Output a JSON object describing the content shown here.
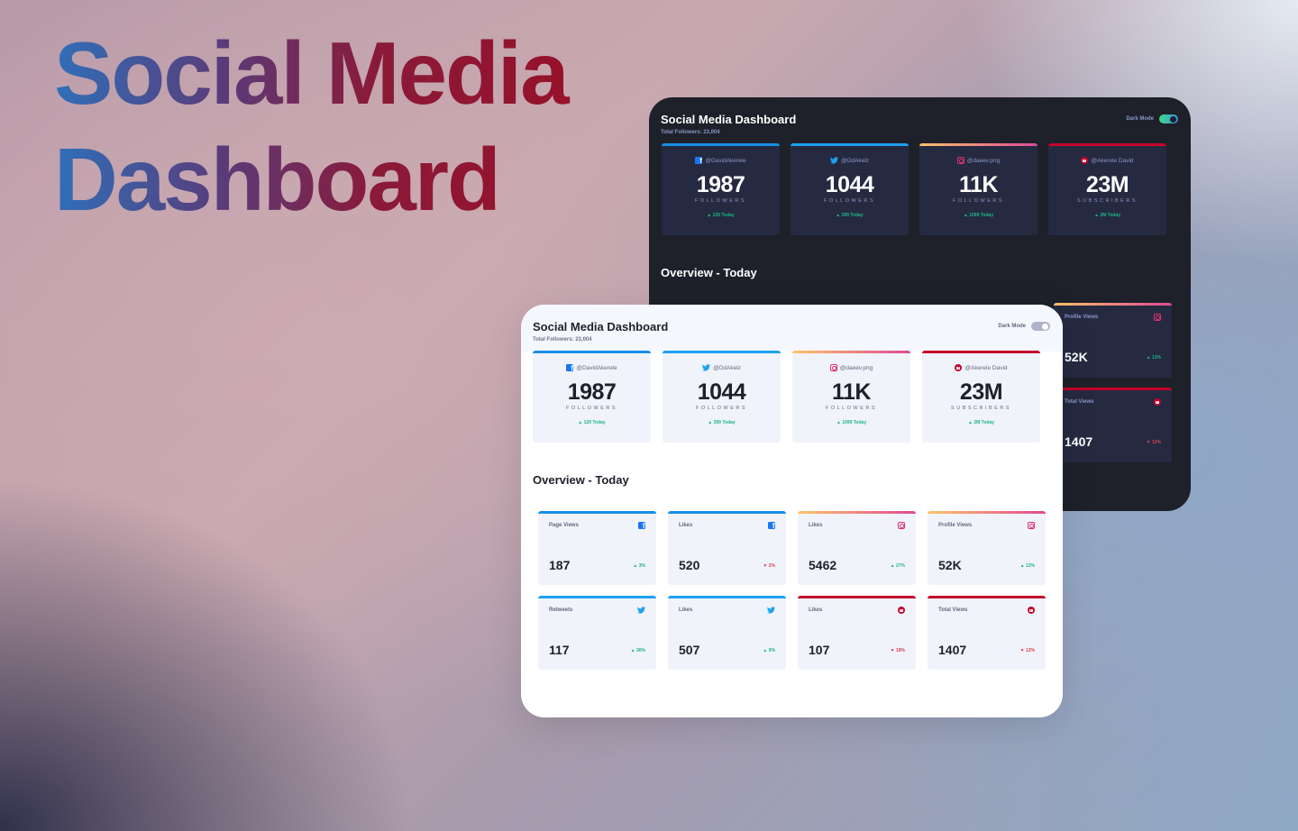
{
  "hero": {
    "line1": "Social Media",
    "line2": "Dashboard"
  },
  "colors": {
    "facebook": "#1877f2",
    "twitter": "#1da1f2",
    "instagram_gradient": [
      "#fdc468",
      "#df4996"
    ],
    "youtube": "#c4032b",
    "up": "#1eb589",
    "down": "#dc414c"
  },
  "dark": {
    "title": "Social Media Dashboard",
    "total": "Total Followers: 23,004",
    "toggle_label": "Dark Mode",
    "followers": [
      {
        "icon": "facebook-icon",
        "handle": "@DavidAkerele",
        "count": "1987",
        "unit": "FOLLOWERS",
        "today": "▲ 129 Today"
      },
      {
        "icon": "twitter-icon",
        "handle": "@DdAkelz",
        "count": "1044",
        "unit": "FOLLOWERS",
        "today": "▲ 399 Today"
      },
      {
        "icon": "instagram-icon",
        "handle": "@daeev.png",
        "count": "11K",
        "unit": "FOLLOWERS",
        "today": "▲ 1099 Today"
      },
      {
        "icon": "youtube-icon",
        "handle": "@Akerele David",
        "count": "23M",
        "unit": "SUBSCRIBERS",
        "today": "▲ 2M Today"
      }
    ],
    "overview_title": "Overview - Today",
    "overview": [
      {
        "icon": "instagram-icon",
        "label": "Profile Views",
        "value": "52K",
        "change": "▲ 13%",
        "dir": "up"
      },
      {
        "icon": "youtube-icon",
        "label": "Total Views",
        "value": "1407",
        "change": "▼ 12%",
        "dir": "down"
      }
    ]
  },
  "light": {
    "title": "Social Media Dashboard",
    "total": "Total Followers: 23,004",
    "toggle_label": "Dark Mode",
    "followers": [
      {
        "icon": "facebook-icon",
        "handle": "@DavidAkerele",
        "count": "1987",
        "unit": "FOLLOWERS",
        "today": "▲ 129 Today"
      },
      {
        "icon": "twitter-icon",
        "handle": "@DdAkelz",
        "count": "1044",
        "unit": "FOLLOWERS",
        "today": "▲ 399 Today"
      },
      {
        "icon": "instagram-icon",
        "handle": "@daeev.png",
        "count": "11K",
        "unit": "FOLLOWERS",
        "today": "▲ 1099 Today"
      },
      {
        "icon": "youtube-icon",
        "handle": "@Akerele David",
        "count": "23M",
        "unit": "SUBSCRIBERS",
        "today": "▲ 2M Today"
      }
    ],
    "overview_title": "Overview - Today",
    "overview": [
      {
        "icon": "facebook-icon",
        "label": "Page Views",
        "value": "187",
        "change": "▲ 3%",
        "dir": "up"
      },
      {
        "icon": "facebook-icon",
        "label": "Likes",
        "value": "520",
        "change": "▼ 2%",
        "dir": "down"
      },
      {
        "icon": "instagram-icon",
        "label": "Likes",
        "value": "5462",
        "change": "▲ 27%",
        "dir": "up"
      },
      {
        "icon": "instagram-icon",
        "label": "Profile Views",
        "value": "52K",
        "change": "▲ 13%",
        "dir": "up"
      },
      {
        "icon": "twitter-icon",
        "label": "Retweets",
        "value": "117",
        "change": "▲ 30%",
        "dir": "up"
      },
      {
        "icon": "twitter-icon",
        "label": "Likes",
        "value": "507",
        "change": "▲ 9%",
        "dir": "up"
      },
      {
        "icon": "youtube-icon",
        "label": "Likes",
        "value": "107",
        "change": "▼ 19%",
        "dir": "down"
      },
      {
        "icon": "youtube-icon",
        "label": "Total Views",
        "value": "1407",
        "change": "▼ 12%",
        "dir": "down"
      }
    ]
  }
}
